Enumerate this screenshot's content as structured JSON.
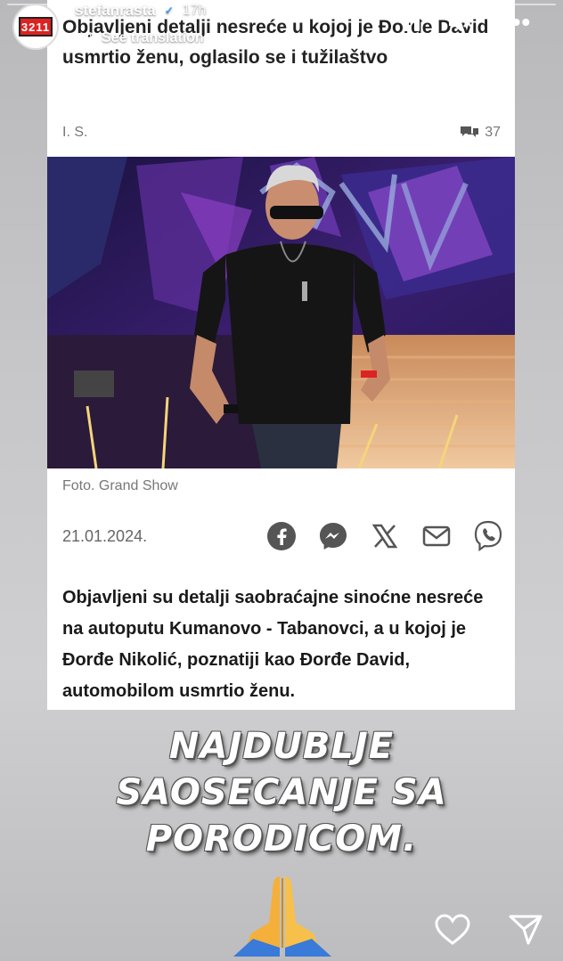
{
  "story": {
    "username": "stefanrasta",
    "time": "17h",
    "see_translation": "See translation",
    "avatar_text": "3211"
  },
  "article": {
    "headline": "Objavljeni detalji nesreće u kojoj je Đorđe David usmrtio ženu, oglasilo se i tužilaštvo",
    "author": "I. S.",
    "comment_count": "37",
    "photo_caption": "Foto. Grand Show",
    "date": "21.01.2024.",
    "lede": "Objavljeni su detalji saobraćajne sinoćne nesreće na autoputu Kumanovo - Tabanovci, a u kojoj je Đorđe Nikolić, poznatiji kao Đorđe David, automobilom usmrtio ženu."
  },
  "overlay": {
    "line1": "NAJDUBLJE",
    "line2": "SAOSECANJE SA",
    "line3": "PORODICOM."
  },
  "icons": {
    "share": [
      "facebook-icon",
      "messenger-icon",
      "x-icon",
      "mail-icon",
      "viber-icon"
    ],
    "footer": [
      "heart-icon",
      "send-icon"
    ]
  },
  "colors": {
    "accent_red": "#dd2222",
    "share_gray": "#555555"
  }
}
